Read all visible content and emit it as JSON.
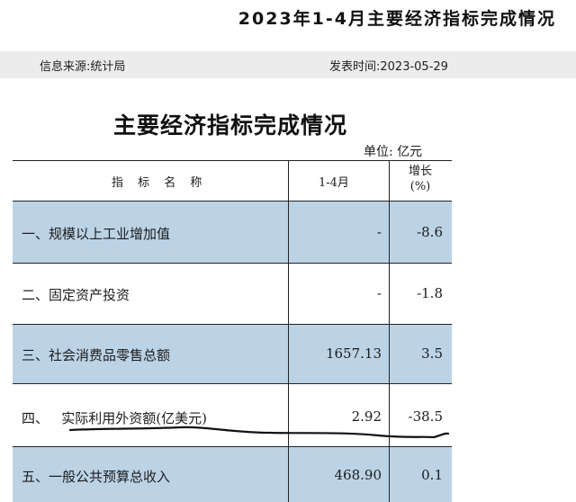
{
  "header": {
    "title": "2023年1-4月主要经济指标完成情况",
    "source": "信息来源:统计局",
    "published": "发表时间:2023-05-29"
  },
  "document": {
    "title": "主要经济指标完成情况",
    "unit": "单位: 亿元",
    "columns": {
      "name": "指 标 名 称",
      "period": "1-4月",
      "growth_line1": "增长",
      "growth_line2": "(%)"
    },
    "rows": [
      {
        "name": "一、规模以上工业增加值",
        "value": "-",
        "growth": "-8.6",
        "shaded": true
      },
      {
        "name": "二、固定资产投资",
        "value": "-",
        "growth": "-1.8",
        "shaded": false
      },
      {
        "name": "三、社会消费品零售总额",
        "value": "1657.13",
        "growth": "3.5",
        "shaded": true
      },
      {
        "name": "四、   实际利用外资额(亿美元)",
        "value": "2.92",
        "growth": "-38.5",
        "shaded": false
      },
      {
        "name": "五、一般公共预算总收入",
        "value": "468.90",
        "growth": "0.1",
        "shaded": true
      }
    ],
    "colors": {
      "row_shade": "#bcd3e6",
      "info_bar": "#ececec"
    }
  }
}
